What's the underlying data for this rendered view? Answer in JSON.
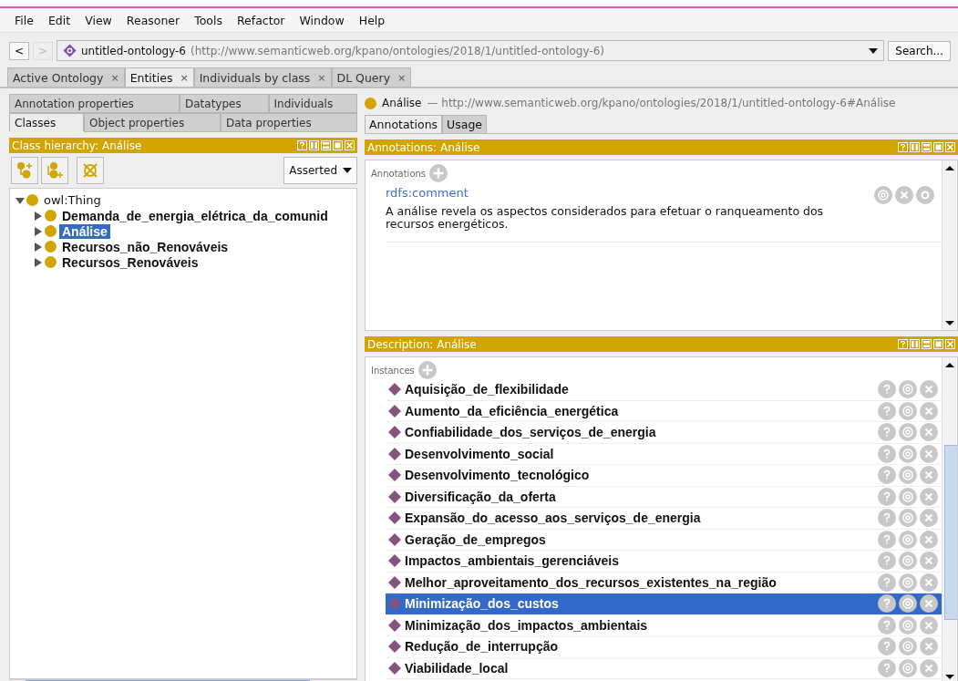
{
  "menu": [
    "File",
    "Edit",
    "View",
    "Reasoner",
    "Tools",
    "Refactor",
    "Window",
    "Help"
  ],
  "nav": {
    "back": "<",
    "forward": ">",
    "ontology_name": "untitled-ontology-6",
    "ontology_iri": "(http://www.semanticweb.org/kpano/ontologies/2018/1/untitled-ontology-6)",
    "search_button": "Search..."
  },
  "workspace_tabs": [
    {
      "label": "Active Ontology",
      "selected": false,
      "close": "×"
    },
    {
      "label": "Entities",
      "selected": true,
      "close": "×"
    },
    {
      "label": "Individuals by class",
      "selected": false,
      "close": "×"
    },
    {
      "label": "DL Query",
      "selected": false,
      "close": "×"
    }
  ],
  "entity_tabs": [
    [
      {
        "label": "Annotation properties",
        "selected": false
      },
      {
        "label": "Datatypes",
        "selected": false
      },
      {
        "label": "Individuals",
        "selected": false
      }
    ],
    [
      {
        "label": "Classes",
        "selected": true
      },
      {
        "label": "Object properties",
        "selected": false
      },
      {
        "label": "Data properties",
        "selected": false
      }
    ]
  ],
  "class_hierarchy": {
    "title": "Class hierarchy: Análise",
    "mode": "Asserted",
    "tree": [
      {
        "label": "owl:Thing",
        "expanded": true,
        "selected": false,
        "children": [
          {
            "label": "Demanda_de_energia_elétrica_da_comunid",
            "expanded": false,
            "selected": false
          },
          {
            "label": "Análise",
            "expanded": false,
            "selected": true
          },
          {
            "label": "Recursos_não_Renováveis",
            "expanded": false,
            "selected": false
          },
          {
            "label": "Recursos_Renováveis",
            "expanded": false,
            "selected": false
          }
        ]
      }
    ]
  },
  "entity_header": {
    "name": "Análise",
    "iri": "— http://www.semanticweb.org/kpano/ontologies/2018/1/untitled-ontology-6#Análise"
  },
  "entity_view_tabs": [
    {
      "label": "Annotations",
      "selected": true
    },
    {
      "label": "Usage",
      "selected": false
    }
  ],
  "annotations_panel": {
    "title": "Annotations: Análise",
    "section_label": "Annotations",
    "items": [
      {
        "property": "rdfs:comment",
        "value": "A análise revela os aspectos considerados para efetuar o ranqueamento dos recursos energéticos."
      }
    ]
  },
  "description_panel": {
    "title": "Description: Análise",
    "section_label": "Instances",
    "instances": [
      {
        "label": "Aquisição_de_flexibilidade",
        "selected": false
      },
      {
        "label": "Aumento_da_eficiência_energética",
        "selected": false
      },
      {
        "label": "Confiabilidade_dos_serviços_de_energia",
        "selected": false
      },
      {
        "label": "Desenvolvimento_social",
        "selected": false
      },
      {
        "label": "Desenvolvimento_tecnológico",
        "selected": false
      },
      {
        "label": "Diversificação_da_oferta",
        "selected": false
      },
      {
        "label": "Expansão_do_acesso_aos_serviços_de_energia",
        "selected": false
      },
      {
        "label": "Geração_de_empregos",
        "selected": false
      },
      {
        "label": "Impactos_ambientais_gerenciáveis",
        "selected": false
      },
      {
        "label": "Melhor_aproveitamento_dos_recursos_existentes_na_região",
        "selected": false
      },
      {
        "label": "Minimização_dos_custos",
        "selected": true
      },
      {
        "label": "Minimização_dos_impactos_ambientais",
        "selected": false
      },
      {
        "label": "Redução_de_interrupção",
        "selected": false
      },
      {
        "label": "Viabilidade_local",
        "selected": false
      }
    ]
  }
}
